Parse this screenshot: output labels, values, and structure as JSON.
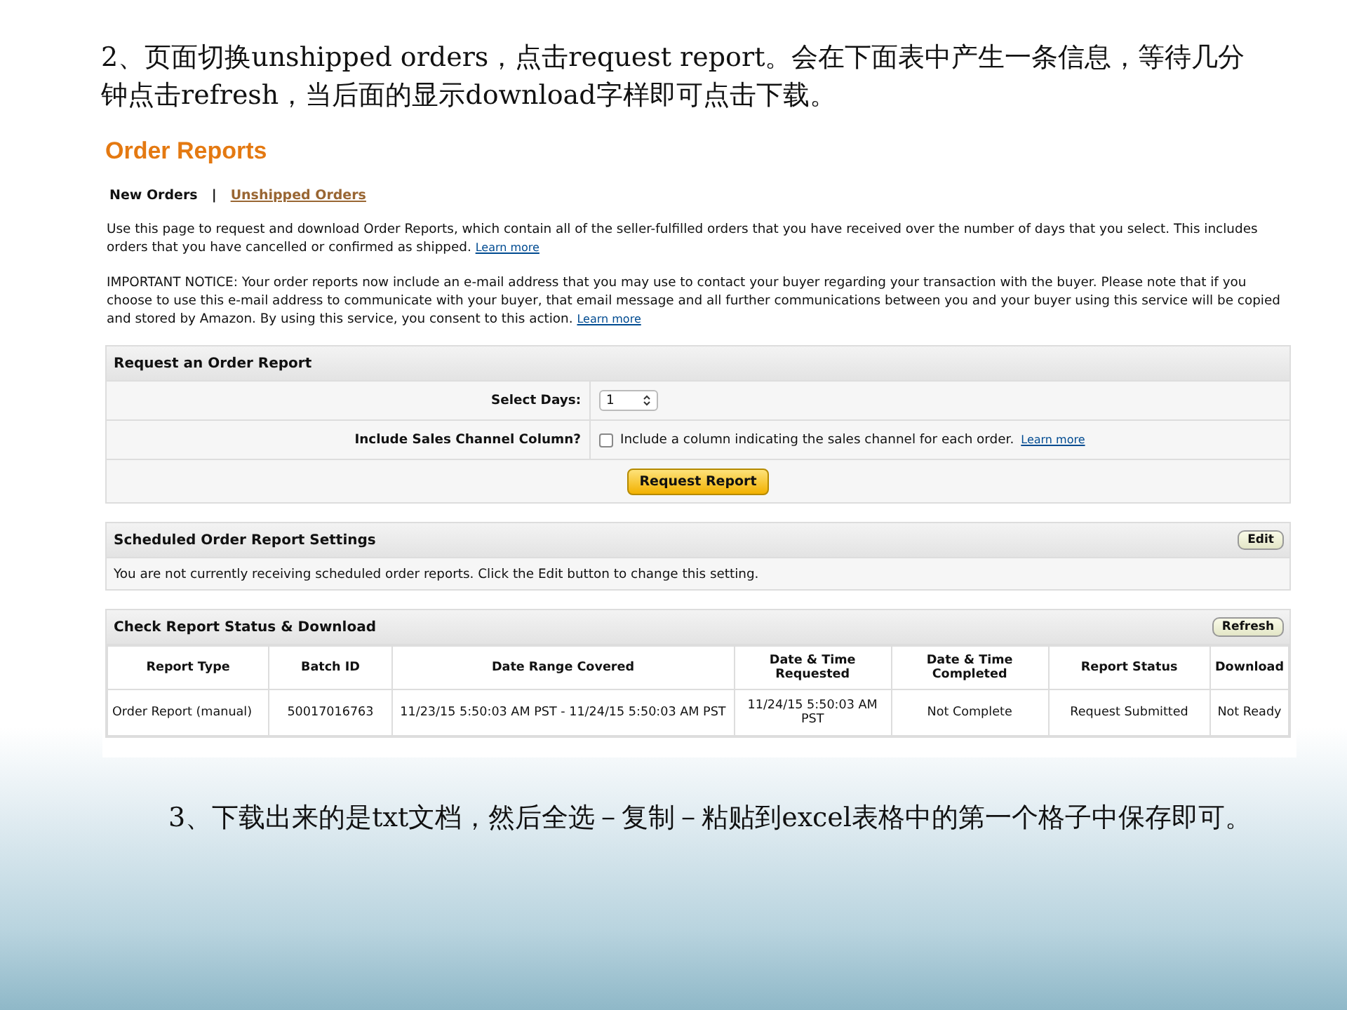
{
  "step_2": "2、页面切换unshipped orders，点击request report。会在下面表中产生一条信息，等待几分钟点击refresh，当后面的显示download字样即可点击下载。",
  "screenshot": {
    "title": "Order Reports",
    "tabs": [
      {
        "label": "New Orders",
        "selected": true
      },
      {
        "label": "Unshipped Orders",
        "selected": false
      }
    ],
    "separator": "|",
    "intro": {
      "text": "Use this page to request and download Order Reports, which contain all of the seller-fulfilled orders that you have received over the number of days that you select. This includes orders that you have cancelled or confirmed as shipped.",
      "link": "Learn more"
    },
    "notice": {
      "text": "IMPORTANT NOTICE: Your order reports now include an e-mail address that you may use to contact your buyer regarding your transaction with the buyer. Please note that if you choose to use this e-mail address to communicate with your buyer, that email message and all further communications between you and your buyer using this service will be copied and stored by Amazon. By using this service, you consent to this action.",
      "link": "Learn more"
    },
    "request_panel": {
      "title": "Request an Order Report",
      "select_days": {
        "label": "Select Days:",
        "value": "1"
      },
      "sales_channel": {
        "label": "Include Sales Channel Column?",
        "checked": false,
        "text": "Include a column indicating the sales channel for each order.",
        "link": "Learn more"
      },
      "button": "Request Report"
    },
    "scheduled_panel": {
      "title": "Scheduled Order Report Settings",
      "button": "Edit",
      "text": "You are not currently receiving scheduled order reports. Click the Edit button to change this setting."
    },
    "status_panel": {
      "title": "Check Report Status & Download",
      "button": "Refresh",
      "columns": [
        "Report Type",
        "Batch ID",
        "Date Range Covered",
        "Date & Time Requested",
        "Date & Time Completed",
        "Report Status",
        "Download"
      ],
      "rows": [
        [
          "Order Report (manual)",
          "50017016763",
          "11/23/15 5:50:03 AM PST - 11/24/15 5:50:03 AM PST",
          "11/24/15 5:50:03 AM PST",
          "Not Complete",
          "Request Submitted",
          "Not Ready"
        ]
      ]
    }
  },
  "step_3": "3、下载出来的是txt文档，然后全选－复制－粘贴到excel表格中的第一个格子中保存即可。"
}
